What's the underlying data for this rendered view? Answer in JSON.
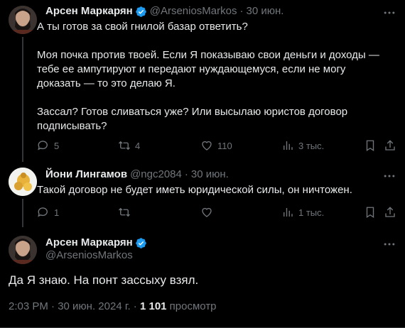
{
  "tweet1": {
    "name": "Арсен Маркарян",
    "handle": "@ArseniosMarkos",
    "separator": "·",
    "date": "30 июн.",
    "text": "А ты готов за свой гнилой базар ответить?\n\nМоя почка против твоей. Если Я показываю свои деньги и доходы — тебе ее ампутируют и передают нуждающемуся, если не могу доказать — то это делаю Я.\n\nЗассал? Готов сливаться уже? Или высылаю юристов договор подписывать?",
    "replies": "5",
    "reposts": "4",
    "likes": "110",
    "views": "3 тыс."
  },
  "tweet2": {
    "name": "Йони Лингамов",
    "handle": "@ngc2084",
    "separator": "·",
    "date": "30 июн.",
    "text": "Такой договор не будет иметь юридической силы, он ничтожен.",
    "replies": "1",
    "reposts": "",
    "likes": "",
    "views": "1 тыс."
  },
  "tweet3": {
    "name": "Арсен Маркарян",
    "handle": "@ArseniosMarkos",
    "text": "Да Я знаю. На понт зассыху взял.",
    "timestamp": "2:03 PM · 30 июн. 2024 г. · ",
    "view_count": "1 101",
    "view_label": " просмотр"
  },
  "colors": {
    "background": "#000000",
    "text": "#e7e9ea",
    "muted": "#71767b",
    "verified": "#1d9bf0",
    "divider": "#2f3336"
  }
}
